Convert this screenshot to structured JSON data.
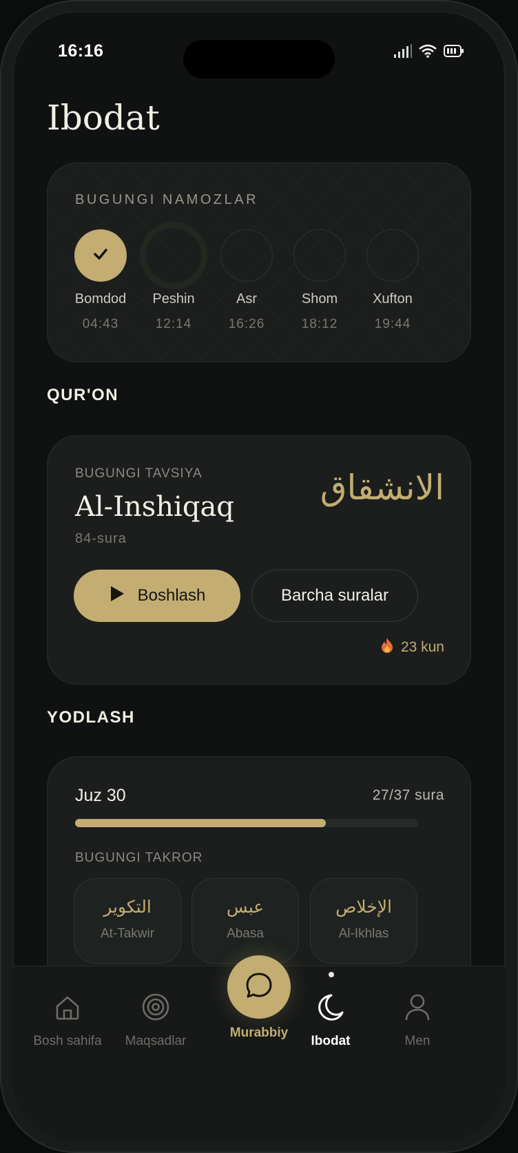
{
  "status_bar": {
    "time": "16:16"
  },
  "page": {
    "title": "Ibodat"
  },
  "prayers": {
    "heading": "BUGUNGI NAMOZLAR",
    "items": [
      {
        "name": "Bomdod",
        "time": "04:43",
        "state": "done"
      },
      {
        "name": "Peshin",
        "time": "12:14",
        "state": "current"
      },
      {
        "name": "Asr",
        "time": "16:26",
        "state": "upcoming"
      },
      {
        "name": "Shom",
        "time": "18:12",
        "state": "upcoming"
      },
      {
        "name": "Xufton",
        "time": "19:44",
        "state": "upcoming"
      }
    ]
  },
  "quran": {
    "section_label": "QUR'ON",
    "kicker": "BUGUNGI TAVSIYA",
    "surah_title": "Al-Inshiqaq",
    "surah_sub": "84-sura",
    "surah_arabic": "الانشقاق",
    "start_label": "Boshlash",
    "all_label": "Barcha suralar",
    "streak": "23 kun",
    "streak_icon": "flame-icon"
  },
  "memorize": {
    "section_label": "YODLASH",
    "juz": "Juz 30",
    "count": "27/37 sura",
    "progress": 0.73,
    "kicker": "BUGUNGI TAKROR",
    "surahs": [
      {
        "arabic": "التكوير",
        "latin": "At-Takwir"
      },
      {
        "arabic": "عبس",
        "latin": "Abasa"
      },
      {
        "arabic": "الإخلاص",
        "latin": "Al-Ikhlas"
      }
    ]
  },
  "nav": {
    "items": [
      {
        "label": "Bosh sahifa",
        "icon": "home-icon"
      },
      {
        "label": "Maqsadlar",
        "icon": "target-icon"
      },
      {
        "label": "Murabbiy",
        "icon": "chat-icon"
      },
      {
        "label": "Ibodat",
        "icon": "moon-icon",
        "active": true
      },
      {
        "label": "Men",
        "icon": "user-icon"
      }
    ]
  },
  "colors": {
    "accent": "#c3ad72",
    "background": "#0f1211",
    "card": "#1b1e1c"
  }
}
